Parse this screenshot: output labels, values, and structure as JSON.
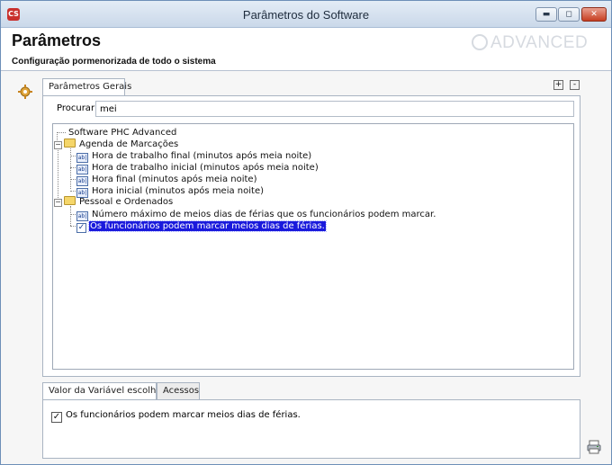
{
  "window": {
    "title": "Parâmetros do Software",
    "app_icon": "phc-icon",
    "controls": {
      "minimize": "▬",
      "maximize": "◻",
      "close": "✕"
    }
  },
  "header": {
    "title": "Parâmetros",
    "subtitle": "Configuração pormenorizada de todo o sistema",
    "logo_text": "ADVANCED"
  },
  "top_tabs": [
    {
      "label": "Parâmetros Gerais",
      "active": true
    }
  ],
  "panel_controls": {
    "expand": "+",
    "collapse": "-"
  },
  "search": {
    "label": "Procurar :",
    "value": "mei"
  },
  "tree": {
    "root": "Software PHC Advanced",
    "groups": [
      {
        "label": "Agenda de Marcações",
        "items": [
          "Hora de trabalho final (minutos após meia noite)",
          "Hora de trabalho inicial (minutos após meia noite)",
          "Hora final (minutos após meia noite)",
          "Hora inicial (minutos após meia noite)"
        ]
      },
      {
        "label": "Pessoal e Ordenados",
        "items": [
          "Número máximo de meios dias de férias que os funcionários podem marcar.",
          "Os funcionários podem marcar meios dias de férias."
        ]
      }
    ],
    "item_icon_text": "ab|"
  },
  "bottom_tabs": [
    {
      "label": "Valor da Variável escolhida",
      "active": true
    },
    {
      "label": "Acessos",
      "active": false
    }
  ],
  "value": {
    "checked": true,
    "check_mark": "✓",
    "label": "Os funcionários podem marcar meios dias de férias."
  },
  "colors": {
    "selection": "#1a1adc",
    "close_button": "#c63d21",
    "folder": "#f5d66a"
  }
}
